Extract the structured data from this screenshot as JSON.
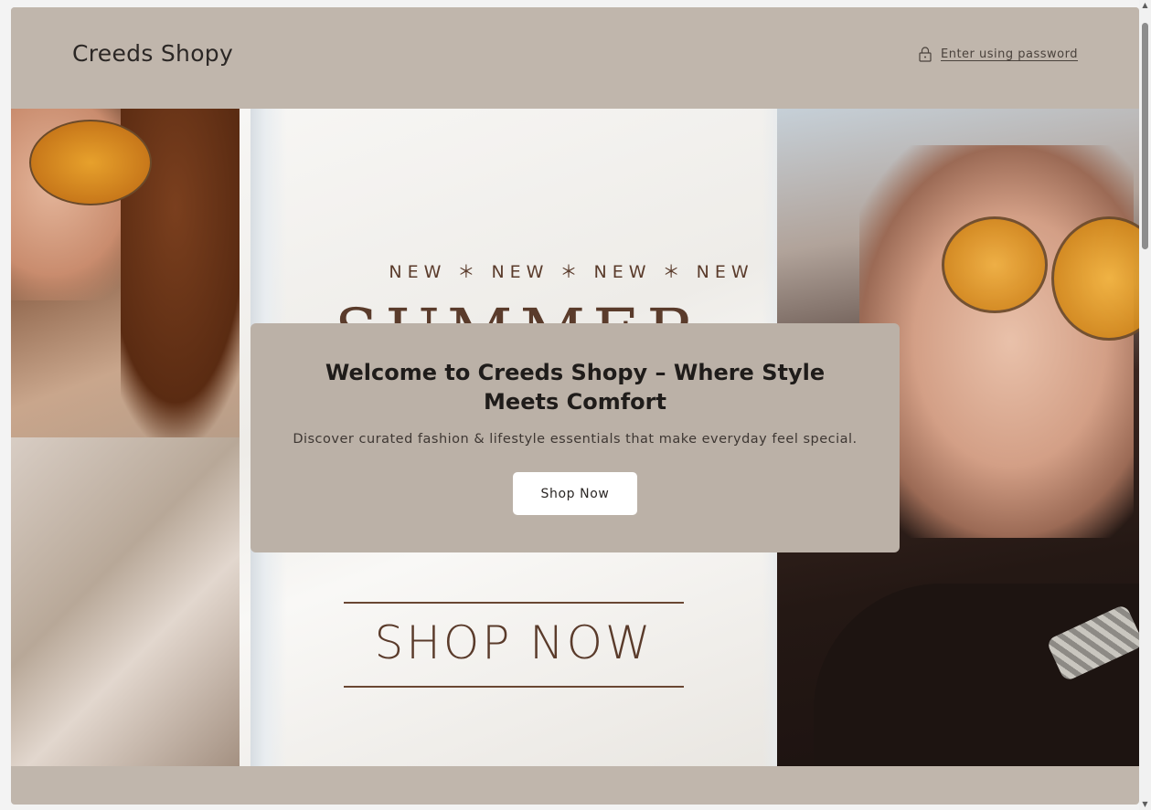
{
  "header": {
    "logo": "Creeds Shopy",
    "password_link": "Enter using password",
    "icon": "lock-icon"
  },
  "banner": {
    "new_line": "NEW ＊ NEW ＊ NEW ＊ NEW",
    "summer": "SUMMER",
    "shop_now": "SHOP NOW"
  },
  "card": {
    "title": "Welcome to Creeds Shopy – Where Style Meets Comfort",
    "subtitle": "Discover curated fashion & lifestyle essentials that make everyday feel special.",
    "button_label": "Shop Now"
  },
  "colors": {
    "page_bg": "#c0b6ac",
    "card_bg": "#bbb1a7",
    "banner_text": "#5a3b2b"
  },
  "scrollbar": {
    "up_glyph": "▲",
    "down_glyph": "▼"
  }
}
